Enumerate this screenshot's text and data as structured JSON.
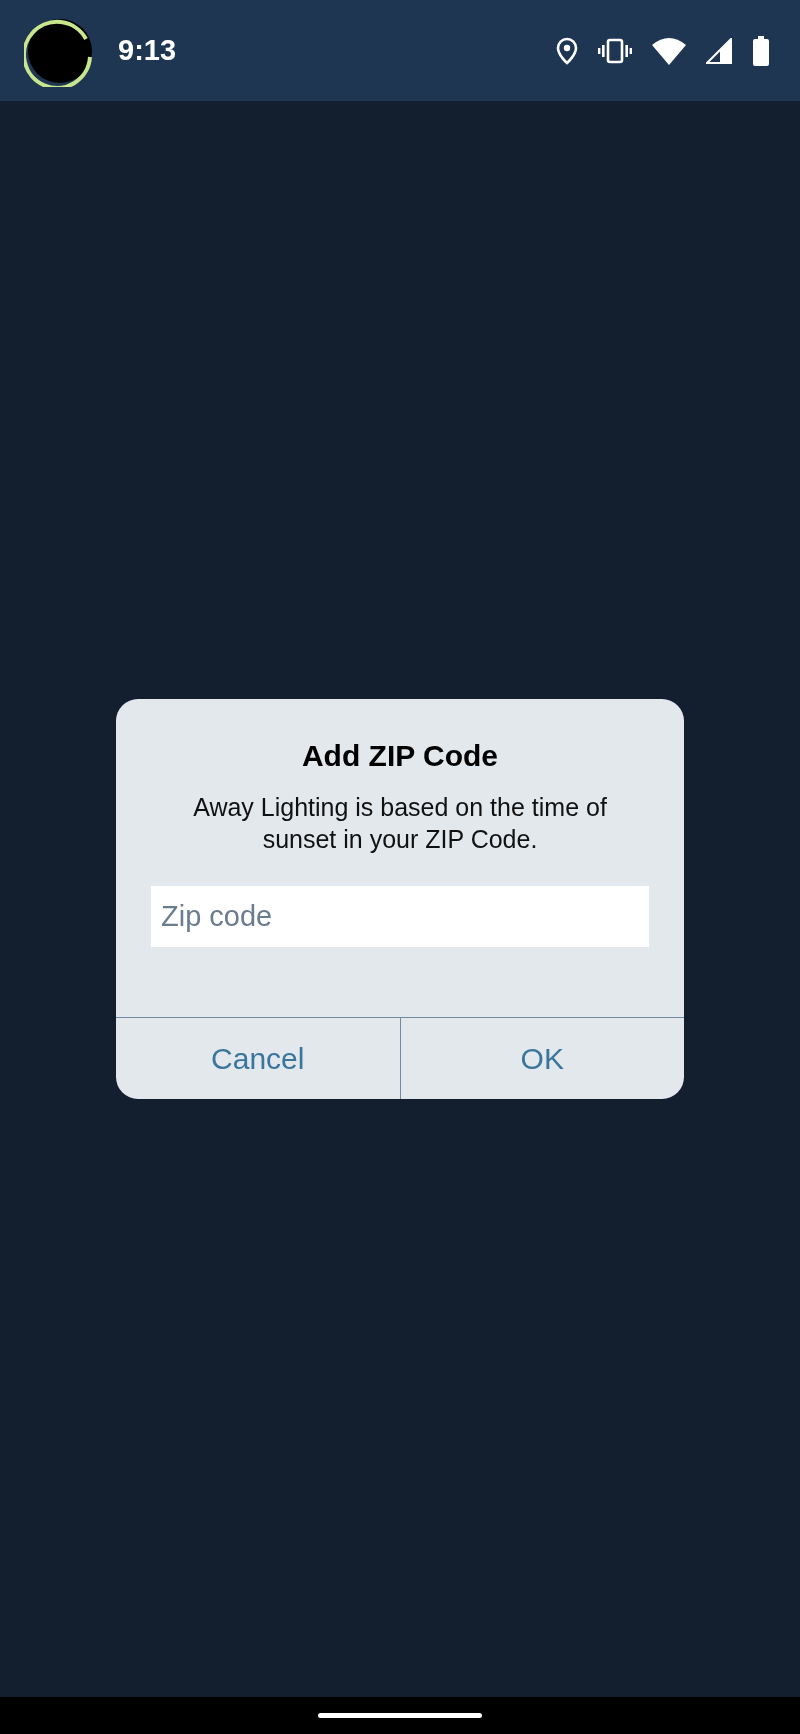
{
  "status_bar": {
    "time": "9:13"
  },
  "dialog": {
    "title": "Add ZIP Code",
    "message": "Away Lighting is based on the time of sunset in your ZIP Code.",
    "zip_field": {
      "placeholder": "Zip code"
    },
    "buttons": [
      {
        "label": "Cancel"
      },
      {
        "label": "OK"
      }
    ]
  }
}
